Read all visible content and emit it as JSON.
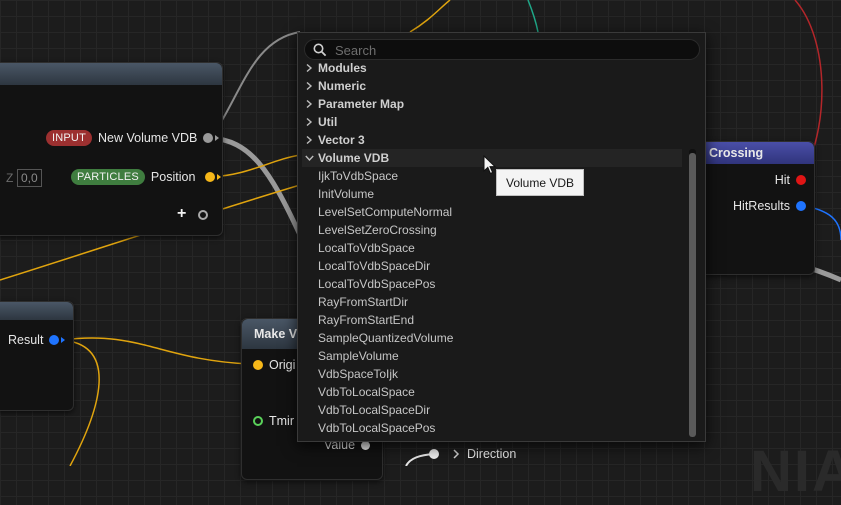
{
  "graph": {
    "input_node": {
      "input_badge": "INPUT",
      "input_label": "New Volume VDB",
      "particles_badge": "PARTICLES",
      "particles_label": "Position",
      "axis_label": "Z",
      "axis_value": "0,0",
      "add_pin_glyph": "+"
    },
    "result_node": {
      "output_label": "Result"
    },
    "crossing_node": {
      "title": "Crossing",
      "hit_label": "Hit",
      "hitresults_label": "HitResults"
    },
    "make_node": {
      "title": "Make V",
      "origin_label": "Origi",
      "tmin_label": "Tmir",
      "value_label": "Value",
      "direction_label": "Direction"
    },
    "watermark": "NIA",
    "colors": {
      "input_badge": "#9c3030",
      "particles_badge": "#3f7d3f",
      "pin_yellow": "#f6b719",
      "pin_blue": "#1f74ff",
      "pin_red": "#e01515",
      "header_purple": "#3b3f8f",
      "wire_grey": "#8a8a8a",
      "wire_yellow": "#e0a40e",
      "wire_teal": "#1fa888",
      "wire_red": "#b3262a"
    }
  },
  "popup": {
    "search_placeholder": "Search",
    "search_icon": "magnifier-icon",
    "categories": [
      {
        "label": "Modules",
        "expanded": false
      },
      {
        "label": "Numeric",
        "expanded": false
      },
      {
        "label": "Parameter Map",
        "expanded": false
      },
      {
        "label": "Util",
        "expanded": false
      },
      {
        "label": "Vector 3",
        "expanded": false
      },
      {
        "label": "Volume VDB",
        "expanded": true
      }
    ],
    "items": [
      "IjkToVdbSpace",
      "InitVolume",
      "LevelSetComputeNormal",
      "LevelSetZeroCrossing",
      "LocalToVdbSpace",
      "LocalToVdbSpaceDir",
      "LocalToVdbSpacePos",
      "RayFromStartDir",
      "RayFromStartEnd",
      "SampleQuantizedVolume",
      "SampleVolume",
      "VdbSpaceToIjk",
      "VdbToLocalSpace",
      "VdbToLocalSpaceDir",
      "VdbToLocalSpacePos"
    ],
    "tooltip": "Volume VDB"
  }
}
